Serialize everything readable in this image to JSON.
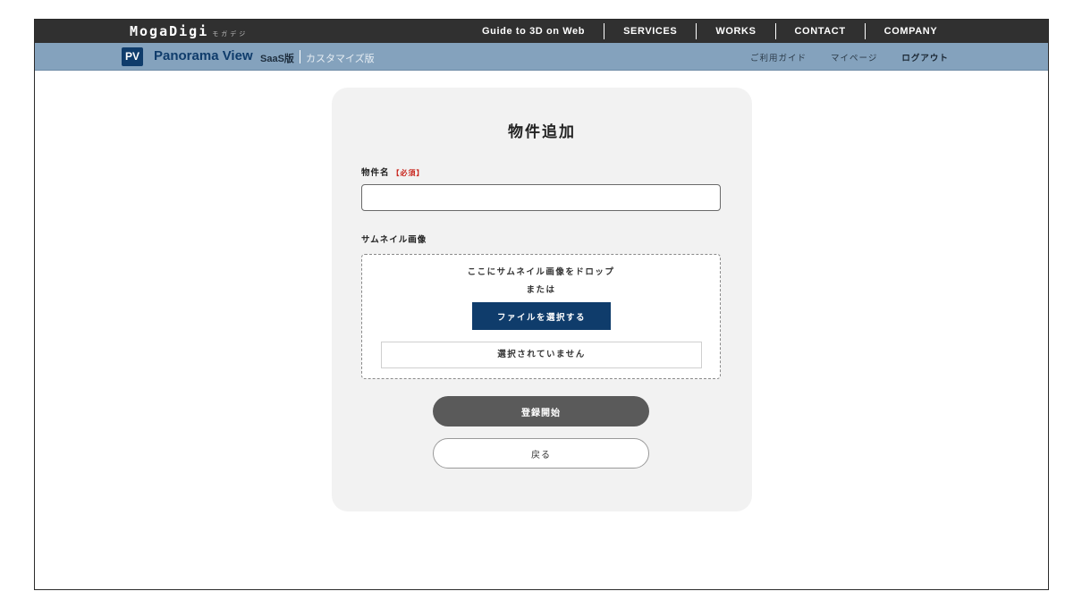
{
  "header": {
    "brand_name": "MogaDigi",
    "brand_sub": "モガデジ",
    "nav": [
      "Guide to 3D on Web",
      "SERVICES",
      "WORKS",
      "CONTACT",
      "COMPANY"
    ]
  },
  "subheader": {
    "badge": "PV",
    "product": "Panorama View",
    "edition": "SaaS版",
    "custom": "カスタマイズ版",
    "nav": [
      "ご利用ガイド",
      "マイページ",
      "ログアウト"
    ]
  },
  "form": {
    "title": "物件追加",
    "name_label": "物件名",
    "required_mark": "【必須】",
    "name_value": "",
    "thumbnail_label": "サムネイル画像",
    "drop_text": "ここにサムネイル画像をドロップ",
    "or_text": "または",
    "file_button": "ファイルを選択する",
    "file_status": "選択されていません",
    "submit_button": "登録開始",
    "back_button": "戻る"
  },
  "colors": {
    "topbar": "#303030",
    "subbar": "#84a2bd",
    "brand_navy": "#0f3c6b",
    "required_red": "#c8241c",
    "submit_gray": "#5a5a5a"
  }
}
